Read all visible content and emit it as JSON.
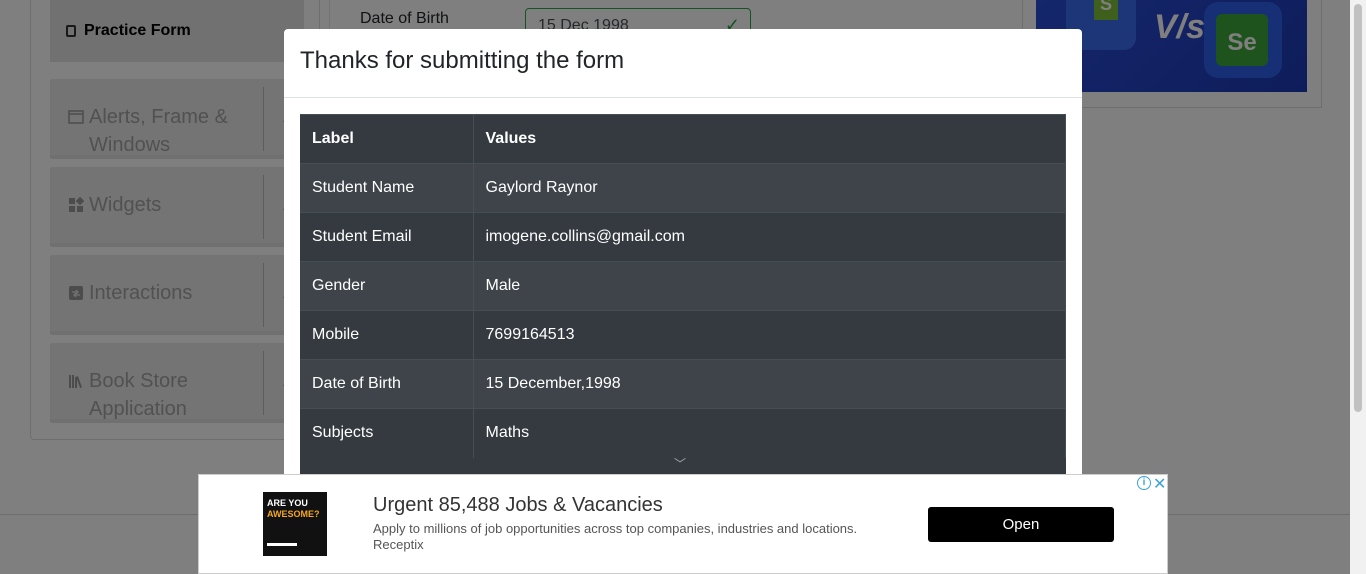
{
  "sidebar": {
    "active_item": "Practice Form",
    "groups": [
      {
        "label": "Alerts, Frame & Windows",
        "icon": "window-icon"
      },
      {
        "label": "Widgets",
        "icon": "widgets-icon"
      },
      {
        "label": "Interactions",
        "icon": "interactions-icon"
      },
      {
        "label": "Book Store Application",
        "icon": "books-icon"
      }
    ]
  },
  "form": {
    "dob_label": "Date of Birth",
    "dob_value": "15 Dec 1998"
  },
  "modal": {
    "title": "Thanks for submitting the form",
    "headers": {
      "label": "Label",
      "values": "Values"
    },
    "rows": [
      {
        "label": "Student Name",
        "value": "Gaylord Raynor"
      },
      {
        "label": "Student Email",
        "value": "imogene.collins@gmail.com"
      },
      {
        "label": "Gender",
        "value": "Male"
      },
      {
        "label": "Mobile",
        "value": "7699164513"
      },
      {
        "label": "Date of Birth",
        "value": "15 December,1998"
      },
      {
        "label": "Subjects",
        "value": "Maths"
      }
    ]
  },
  "ad": {
    "image_text_1": "ARE YOU",
    "image_text_2": "AWESOME?",
    "title": "Urgent 85,488 Jobs & Vacancies",
    "description": "Apply to millions of job opportunities across top companies, industries and locations.",
    "source": "Receptix",
    "button": "Open"
  },
  "banner": {
    "vs_text": "V/s",
    "s_letter": "S",
    "se_letter": "Se"
  },
  "colors": {
    "table_dark": "#343a40",
    "table_stripe": "#3e444a",
    "success": "#28a745",
    "ad_accent": "#3ba3d8"
  }
}
